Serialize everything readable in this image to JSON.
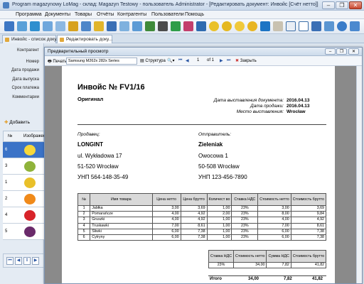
{
  "app": {
    "title": "Program magazynowy LoMag - склад: Magazyn Testowy - пользователь Administrator - [Редактировать документ: Инвойс [Счёт нетто]]",
    "controls": {
      "minimize": "–",
      "maximize": "❐",
      "close": "✕"
    }
  },
  "menu": [
    "Программа",
    "Документы",
    "Товары",
    "Отчёты",
    "Контрагенты",
    "Пользователи",
    "Помощь"
  ],
  "tabs": [
    {
      "label": "Инвойс - список доку..."
    },
    {
      "label": "Редактировать доку..."
    }
  ],
  "form_labels": [
    "Контрагент",
    "Номер",
    "Дата продажи",
    "Дата выпуска",
    "Срок платежа",
    "Комментарии"
  ],
  "add_button": "Добавить",
  "grid": {
    "col_num": "№",
    "col_image": "Изображени",
    "rows": [
      "6",
      "3",
      "1",
      "2",
      "4",
      "5"
    ]
  },
  "preview": {
    "title": "Предварительный просмотр",
    "print_label": "Печать",
    "printer": "Samsung M262x 282x Series",
    "structure_label": "Структура",
    "page_current": "1",
    "page_total": "of 1",
    "close_label": "Закрыть"
  },
  "invoice": {
    "heading": "Инвойс № FV1/16",
    "original": "Оригинал",
    "meta": [
      {
        "label": "Дата выставления документа:",
        "value": "2016.04.13"
      },
      {
        "label": "Дата продажи:",
        "value": "2016.04.13"
      },
      {
        "label": "Место выставления:",
        "value": "Wrocław"
      }
    ],
    "seller_label": "Продавец:",
    "seller": [
      "LONGINT",
      "ul. Wykładowa 17",
      "51-520  Wrocław",
      "УНП 564-148-35-49"
    ],
    "buyer_label": "Отправитель:",
    "buyer": [
      "Zieleniak",
      "Owocowa 1",
      "50-508  Wrocław",
      "УНП 123-456-7890"
    ],
    "items_header": [
      "№",
      "Имя товара",
      "Цена нетто",
      "Цена брутто",
      "Количест во",
      "Ставка НДС",
      "Стоимость нетто",
      "Стоимость брутто"
    ],
    "items": [
      [
        "1",
        "Jabłka",
        "3,00",
        "3,69",
        "1,00",
        "23%",
        "3,00",
        "3,69"
      ],
      [
        "2",
        "Pomarańcze",
        "4,00",
        "4,92",
        "2,00",
        "23%",
        "8,00",
        "9,84"
      ],
      [
        "3",
        "Gruszki",
        "4,00",
        "4,92",
        "1,00",
        "23%",
        "4,00",
        "4,92"
      ],
      [
        "4",
        "Truskawki",
        "7,00",
        "8,61",
        "1,00",
        "23%",
        "7,00",
        "8,61"
      ],
      [
        "5",
        "Śliwki",
        "6,00",
        "7,38",
        "1,00",
        "23%",
        "6,00",
        "7,38"
      ],
      [
        "6",
        "Cytryny",
        "6,00",
        "7,38",
        "1,00",
        "23%",
        "6,00",
        "7,38"
      ]
    ],
    "vat_header": [
      "Ставка НДС",
      "Стоимость нетто",
      "Сумма НДС",
      "Стоимость брутто"
    ],
    "vat_row": [
      "23%",
      "34,00",
      "7,82",
      "41,82"
    ],
    "total_label": "Итого",
    "total": [
      "34,00",
      "7,82",
      "41,82"
    ]
  },
  "colors": {
    "accent": "#3a6fb5",
    "fruits": [
      "#f2c018",
      "#7ea832",
      "#f08a1a",
      "#d8242a",
      "#6a2a6a",
      "#f7d83a"
    ]
  }
}
